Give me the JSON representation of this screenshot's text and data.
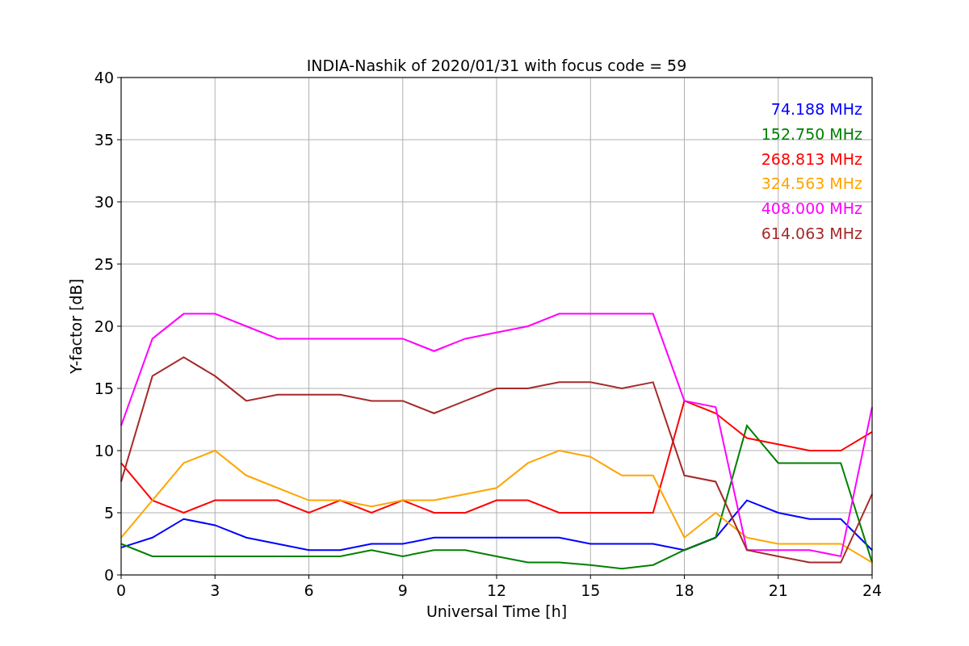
{
  "chart": {
    "chart_data": {
      "type": "line",
      "grid": true,
      "title": "INDIA-Nashik of 2020/01/31 with focus code = 59",
      "xlabel": "Universal Time [h]",
      "ylabel": "Y-factor [dB]",
      "x": [
        0,
        1,
        2,
        3,
        4,
        5,
        6,
        7,
        8,
        9,
        10,
        11,
        12,
        13,
        14,
        15,
        16,
        17,
        18,
        19,
        20,
        21,
        22,
        23,
        24
      ],
      "xlim": [
        0,
        24
      ],
      "ylim": [
        0,
        40
      ],
      "xticks": [
        0,
        3,
        6,
        9,
        12,
        15,
        18,
        21,
        24
      ],
      "yticks": [
        0,
        5,
        10,
        15,
        20,
        25,
        30,
        35,
        40
      ],
      "series": [
        {
          "name": "74.188 MHz",
          "color": "#0000ff",
          "values": [
            2.2,
            3,
            4.5,
            4,
            3,
            2.5,
            2,
            2,
            2.5,
            2.5,
            3,
            3,
            3,
            3,
            3,
            2.5,
            2.5,
            2.5,
            2,
            3,
            6,
            5,
            4.5,
            4.5,
            2
          ]
        },
        {
          "name": "152.750 MHz",
          "color": "#008000",
          "values": [
            2.5,
            1.5,
            1.5,
            1.5,
            1.5,
            1.5,
            1.5,
            1.5,
            2,
            1.5,
            2,
            2,
            1.5,
            1,
            1,
            0.8,
            0.5,
            0.8,
            2,
            3,
            12,
            9,
            9,
            9,
            1
          ]
        },
        {
          "name": "268.813 MHz",
          "color": "#ff0000",
          "values": [
            9,
            6,
            5,
            6,
            6,
            6,
            5,
            6,
            5,
            6,
            5,
            5,
            6,
            6,
            5,
            5,
            5,
            5,
            14,
            13,
            11,
            10.5,
            10,
            10,
            11.5
          ]
        },
        {
          "name": "324.563 MHz",
          "color": "#ffa500",
          "values": [
            3,
            6,
            9,
            10,
            8,
            7,
            6,
            6,
            5.5,
            6,
            6,
            6.5,
            7,
            9,
            10,
            9.5,
            8,
            8,
            3,
            5,
            3,
            2.5,
            2.5,
            2.5,
            1
          ]
        },
        {
          "name": "408.000 MHz",
          "color": "#ff00ff",
          "values": [
            12,
            19,
            21,
            21,
            20,
            19,
            19,
            19,
            19,
            19,
            18,
            19,
            19.5,
            20,
            21,
            21,
            21,
            21,
            14,
            13.5,
            2,
            2,
            2,
            1.5,
            13.5
          ]
        },
        {
          "name": "614.063 MHz",
          "color": "#a52a2a",
          "values": [
            7.5,
            16,
            17.5,
            16,
            14,
            14.5,
            14.5,
            14.5,
            14,
            14,
            13,
            14,
            15,
            15,
            15.5,
            15.5,
            15,
            15.5,
            8,
            7.5,
            2,
            1.5,
            1,
            1,
            6.5
          ]
        }
      ]
    }
  }
}
